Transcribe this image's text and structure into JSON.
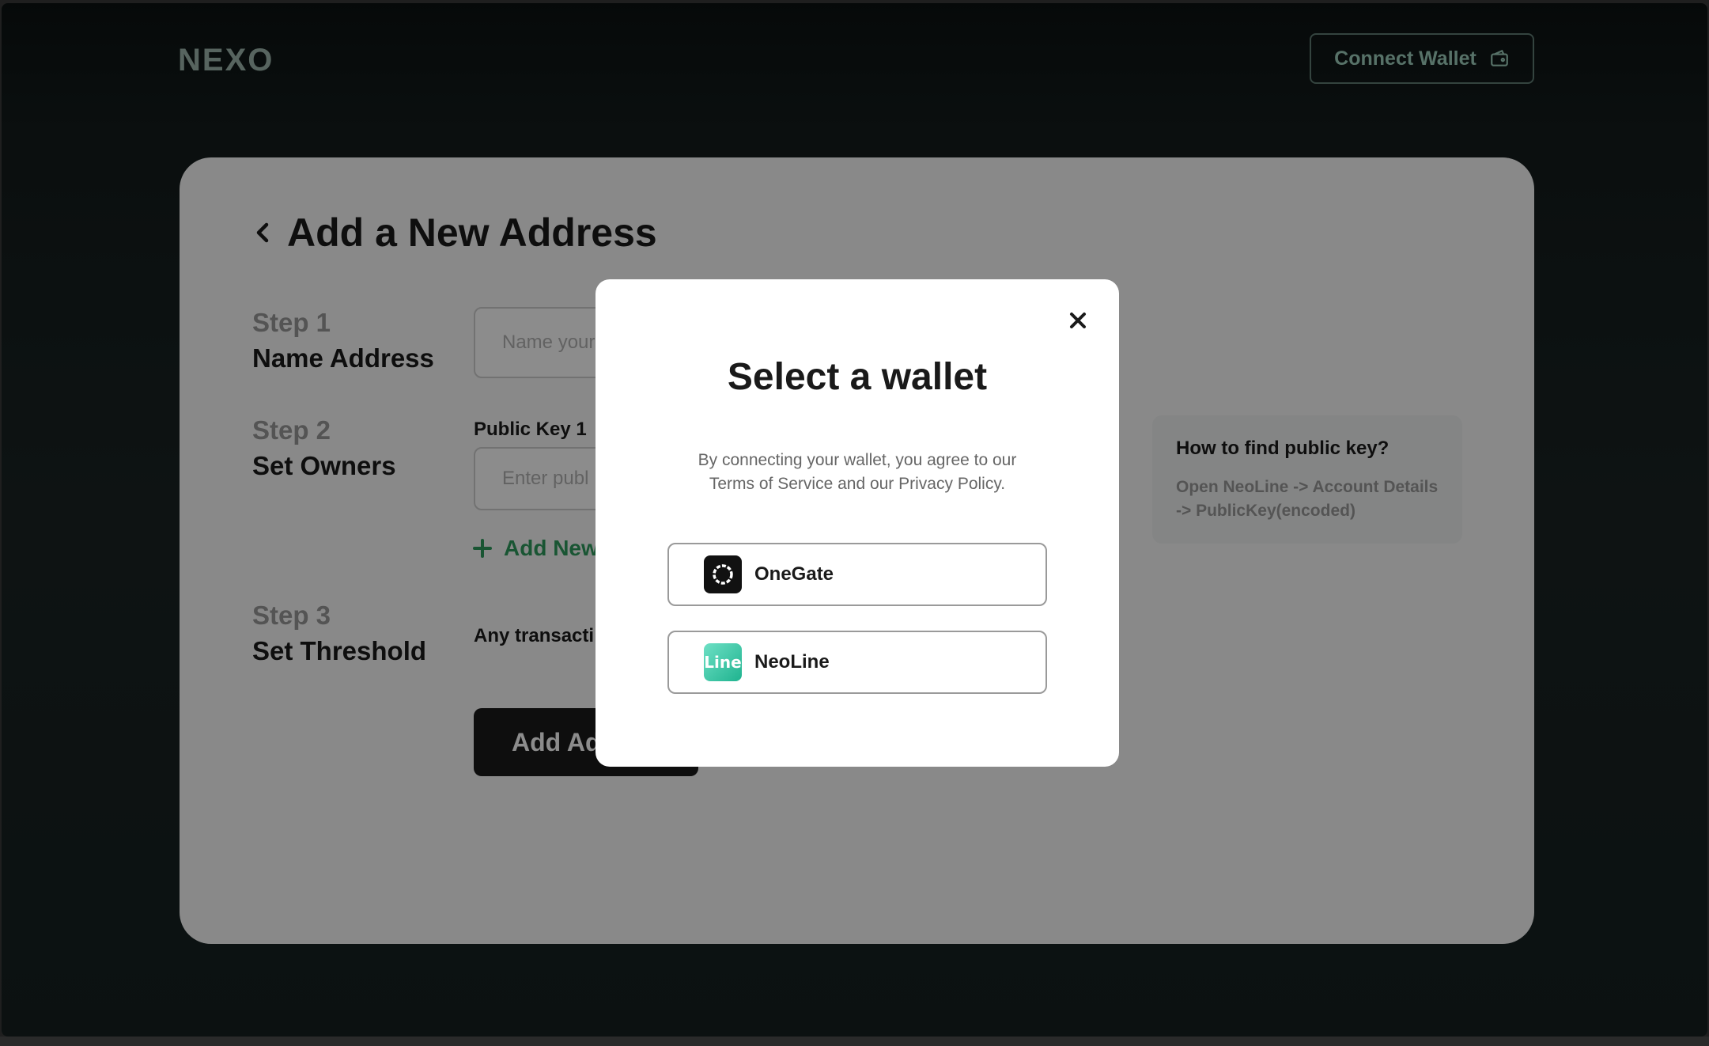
{
  "header": {
    "logo": "NEXO",
    "connect_wallet_label": "Connect Wallet"
  },
  "page": {
    "title": "Add a New Address",
    "step1": {
      "number": "Step 1",
      "name": "Name Address",
      "placeholder": "Name your"
    },
    "step2": {
      "number": "Step 2",
      "name": "Set Owners",
      "field_label": "Public Key 1",
      "placeholder": "Enter publ",
      "add_new_label": "Add New"
    },
    "step3": {
      "number": "Step 3",
      "name": "Set Threshold",
      "text": "Any transacti"
    },
    "submit_label": "Add Ad"
  },
  "help": {
    "title": "How to find public key?",
    "body": "Open NeoLine -> Account Details -> PublicKey(encoded)"
  },
  "modal": {
    "title": "Select a wallet",
    "subtitle_line1": "By connecting your wallet, you agree to our",
    "subtitle_line2": "Terms of Service and our Privacy Policy.",
    "wallets": [
      {
        "name": "OneGate",
        "icon": "onegate-icon"
      },
      {
        "name": "NeoLine",
        "icon": "neoline-icon",
        "icon_text": "Line"
      }
    ]
  },
  "colors": {
    "accent_green": "#2f9c5e",
    "connect_text": "#9fcfbe",
    "logo": "#9fb7ae"
  }
}
